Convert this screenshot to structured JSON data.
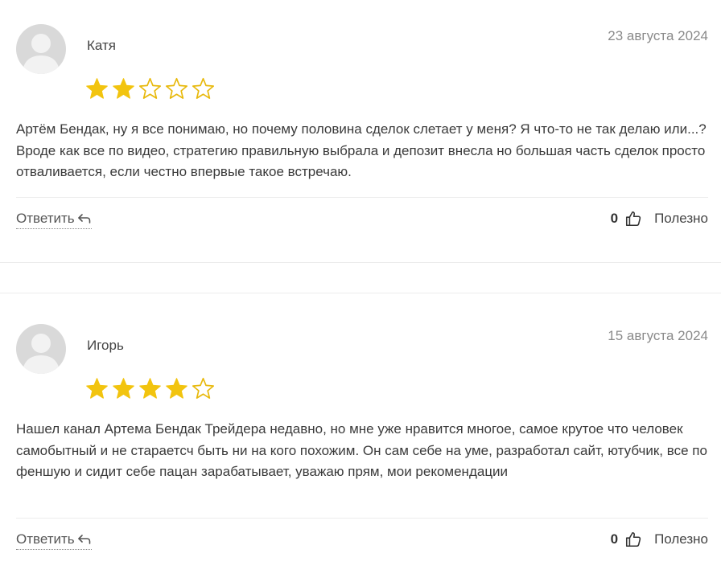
{
  "reviews": [
    {
      "author": "Катя",
      "date": "23 августа 2024",
      "rating": 2,
      "max_rating": 5,
      "text": "Артём Бендак, ну я все понимаю, но почему половина сделок слетает у меня? Я что-то не так делаю или...? Вроде как все по видео, стратегию правильную выбрала и депозит внесла но большая часть сделок просто отваливается, если честно впервые такое встречаю.",
      "reply_label": "Ответить",
      "useful_count": "0",
      "useful_label": "Полезно"
    },
    {
      "author": "Игорь",
      "date": "15 августа 2024",
      "rating": 4,
      "max_rating": 5,
      "text": "Нашел канал Артема Бендак Трейдера недавно, но мне уже нравится многое, самое крутое что человек самобытный и не стараетсч быть ни на кого похожим. Он сам себе на уме, разработал сайт, ютубчик, все по феншую и сидит себе пацан зарабатывает, уважаю прям, мои рекомендации",
      "reply_label": "Ответить",
      "useful_count": "0",
      "useful_label": "Полезно"
    }
  ],
  "colors": {
    "star_filled": "#f2c40f",
    "star_outline": "#e8b90c",
    "avatar_bg": "#d9d9d9",
    "avatar_fg": "#f2f2f2"
  },
  "icons": {
    "avatar": "user-silhouette-icon",
    "star": "star-icon",
    "reply": "reply-arrow-icon",
    "like": "thumbs-up-icon"
  }
}
